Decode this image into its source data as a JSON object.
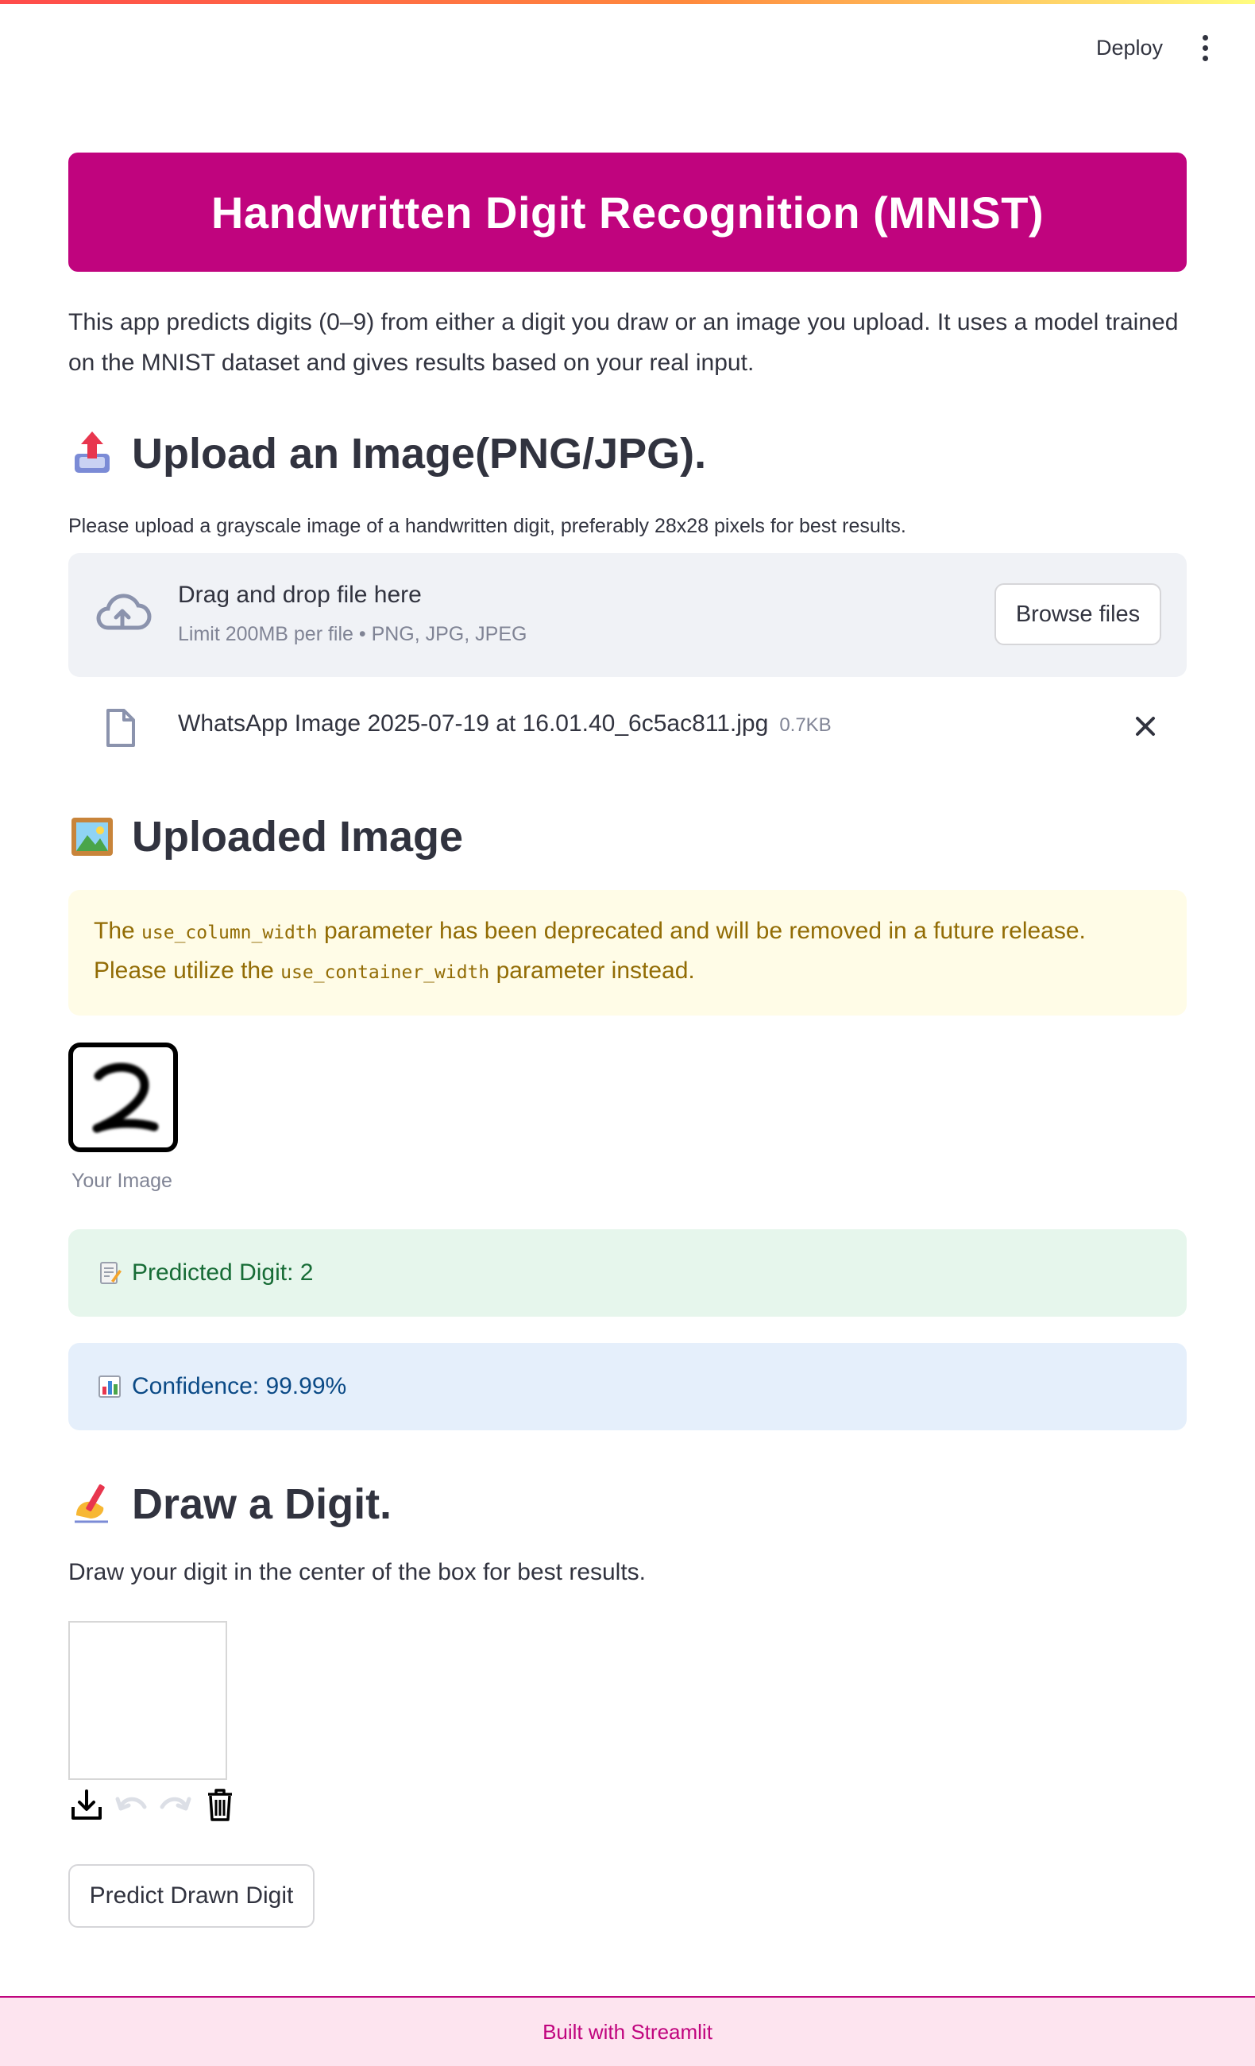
{
  "toolbar": {
    "deploy_label": "Deploy",
    "menu_icon": "more-vertical-icon"
  },
  "banner": {
    "title": "Handwritten Digit Recognition (MNIST)",
    "background_color": "#c0047e"
  },
  "intro_text": "This app predicts digits (0–9) from either a digit you draw or an image you upload. It uses a model trained on the MNIST dataset and gives results based on your real input.",
  "upload_section": {
    "emoji_icon": "outbox-tray-icon",
    "heading": "Upload an Image(PNG/JPG).",
    "instruction": "Please upload a grayscale image of a handwritten digit, preferably 28x28 pixels for best results.",
    "dropzone": {
      "icon": "cloud-upload-icon",
      "title": "Drag and drop file here",
      "limit": "Limit 200MB per file • PNG, JPG, JPEG",
      "browse_label": "Browse files"
    },
    "uploaded_file": {
      "icon": "file-icon",
      "name": "WhatsApp Image 2025-07-19 at 16.01.40_6c5ac811.jpg",
      "size": "0.7KB",
      "remove_icon": "close-icon"
    }
  },
  "uploaded_image_section": {
    "emoji_icon": "framed-picture-icon",
    "heading": "Uploaded Image",
    "warning": {
      "part1": "The",
      "code1": "use_column_width",
      "part2": "parameter has been deprecated and will be removed in a future release. Please utilize the",
      "code2": "use_container_width",
      "part3": "parameter instead."
    },
    "image_caption": "Your Image",
    "prediction": {
      "icon": "memo-icon",
      "text": "Predicted Digit: 2"
    },
    "confidence": {
      "icon": "bar-chart-icon",
      "text": "Confidence: 99.99%"
    }
  },
  "draw_section": {
    "emoji_icon": "writing-hand-icon",
    "heading": "Draw a Digit.",
    "instruction": "Draw your digit in the center of the box for best results.",
    "tools": [
      "download-icon",
      "undo-icon",
      "redo-icon",
      "trash-icon"
    ],
    "predict_label": "Predict Drawn Digit"
  },
  "footer": {
    "text": "Built with Streamlit"
  },
  "colors": {
    "accent": "#c0047e",
    "success_bg": "#e6f6ec",
    "info_bg": "#e5effb",
    "warning_bg": "#fffce7"
  }
}
